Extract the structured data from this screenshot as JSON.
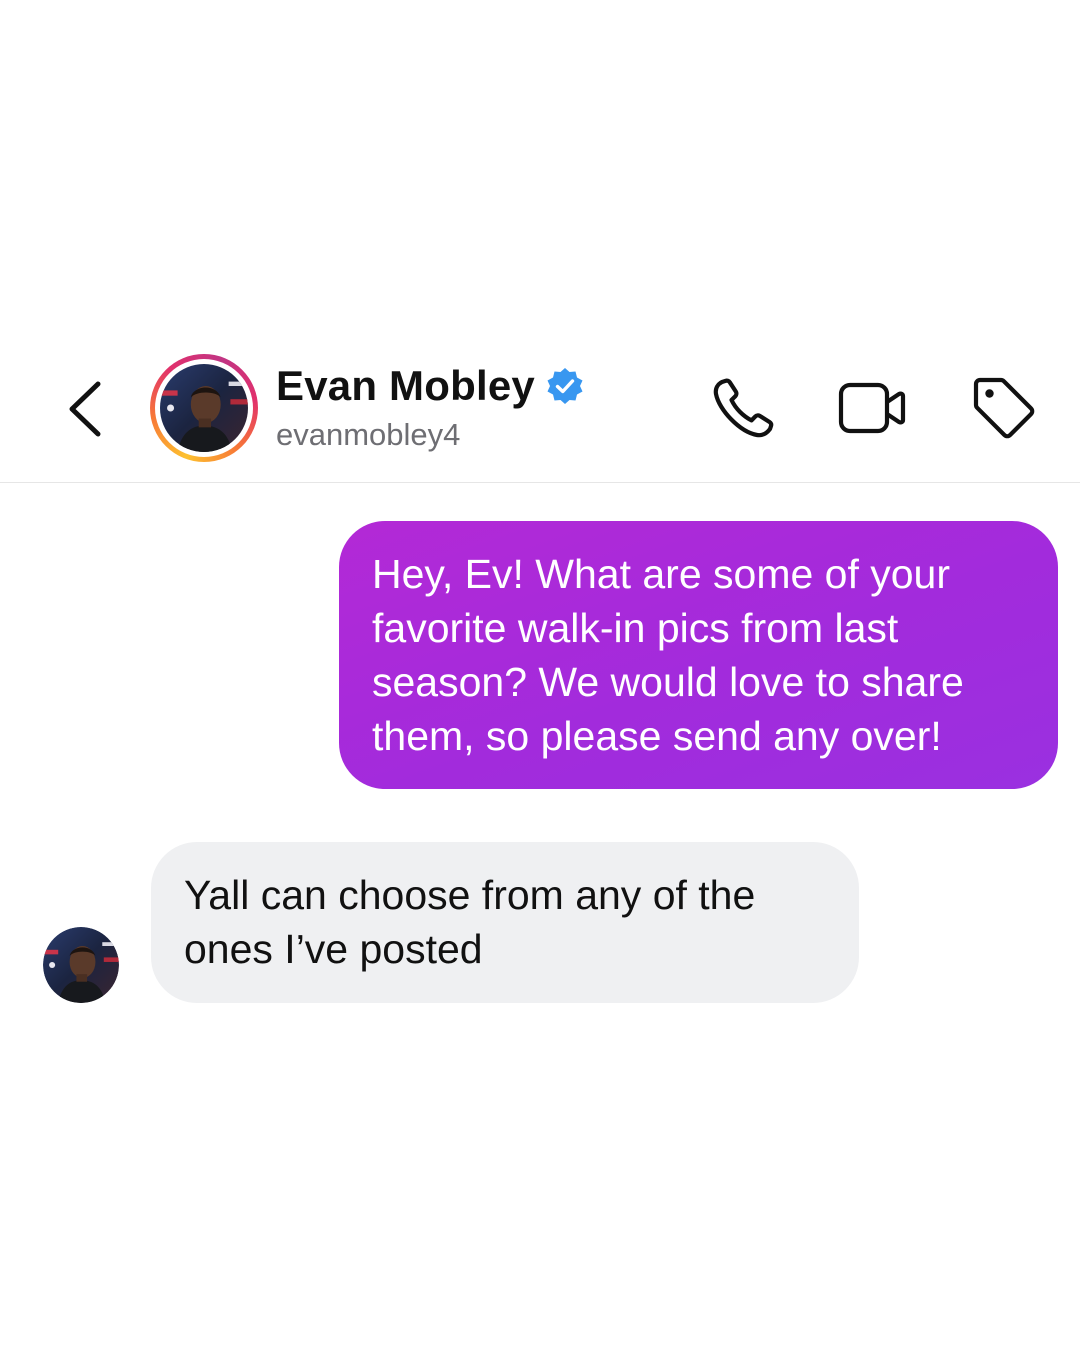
{
  "header": {
    "back_icon": "chevron-left-icon",
    "contact": {
      "name": "Evan Mobley",
      "username": "evanmobley4",
      "verified": true,
      "verified_color": "#3897f0",
      "avatar": "profile-photo-player",
      "story_ring_colors": [
        "#fdc12f",
        "#f77737",
        "#e1306c",
        "#c13584"
      ]
    },
    "actions": [
      {
        "icon": "phone-icon"
      },
      {
        "icon": "video-camera-icon"
      },
      {
        "icon": "tag-icon"
      }
    ]
  },
  "messages": [
    {
      "direction": "outgoing",
      "text": "Hey, Ev! What are some of your\nfavorite walk-in pics from last\nseason? We would love to share\nthem, so please send any over!",
      "color": "#a22bdc"
    },
    {
      "direction": "incoming",
      "sender_avatar": "profile-photo-player",
      "text": "Yall can choose from any of the\nones I’ve posted",
      "color": "#eff0f2"
    }
  ]
}
